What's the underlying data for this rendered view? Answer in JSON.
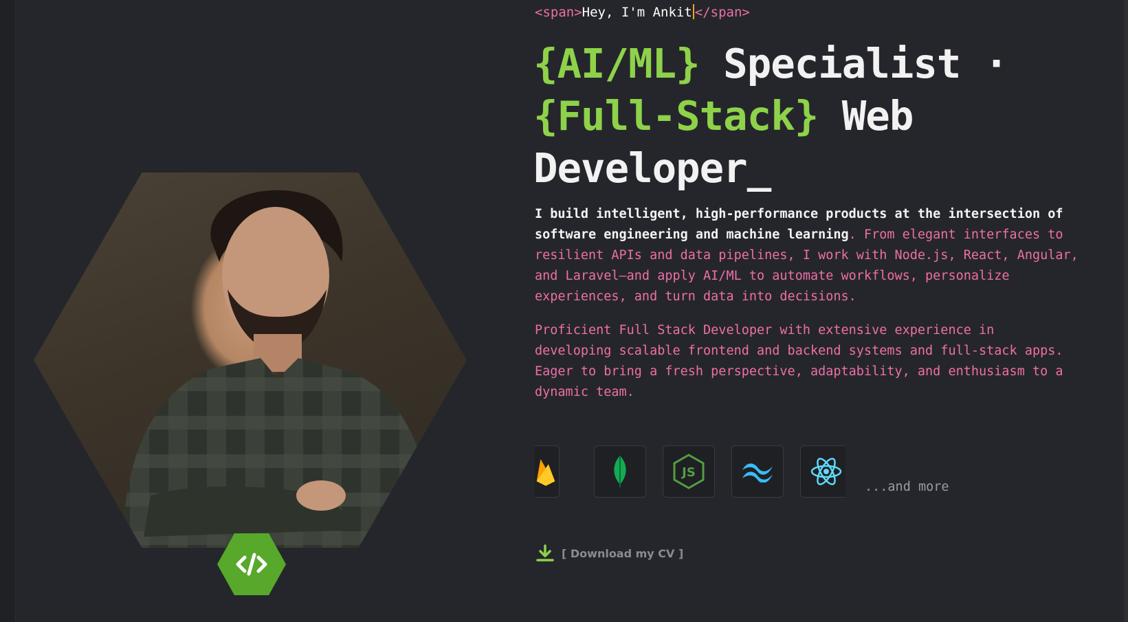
{
  "intro": {
    "open_tag": "<span>",
    "greeting": "Hey, I'm Ankit",
    "close_tag": "</span>"
  },
  "headline": {
    "accent_1": "{AI/ML}",
    "text_1": " Specialist ",
    "separator": "·",
    "accent_2": "{Full-Stack}",
    "text_2": " Web Developer_"
  },
  "about": {
    "para1_lead": "I build intelligent, high-performance products at the intersection of software engineering and machine learning",
    "para1_rest": ". From elegant interfaces to resilient APIs and data pipelines, I work with Node.js, React, Angular, and Laravel—and apply AI/ML to automate workflows, personalize experiences, and turn data into decisions.",
    "para2": "Proficient Full Stack Developer with extensive experience in developing scalable frontend and backend systems and full-stack apps. Eager to bring a fresh perspective, adaptability, and enthusiasm to a dynamic team."
  },
  "tech_stack": {
    "icons": [
      "firebase-icon",
      "mongodb-icon",
      "nodejs-icon",
      "tailwind-icon",
      "react-icon"
    ],
    "more_label": "...and more"
  },
  "cv": {
    "label": "[ Download my CV ]"
  },
  "colors": {
    "background": "#25262b",
    "accent_green": "#8ed24a",
    "pink": "#ee6fa8",
    "badge_green": "#57a82b"
  },
  "badge_icon": "code-icon"
}
